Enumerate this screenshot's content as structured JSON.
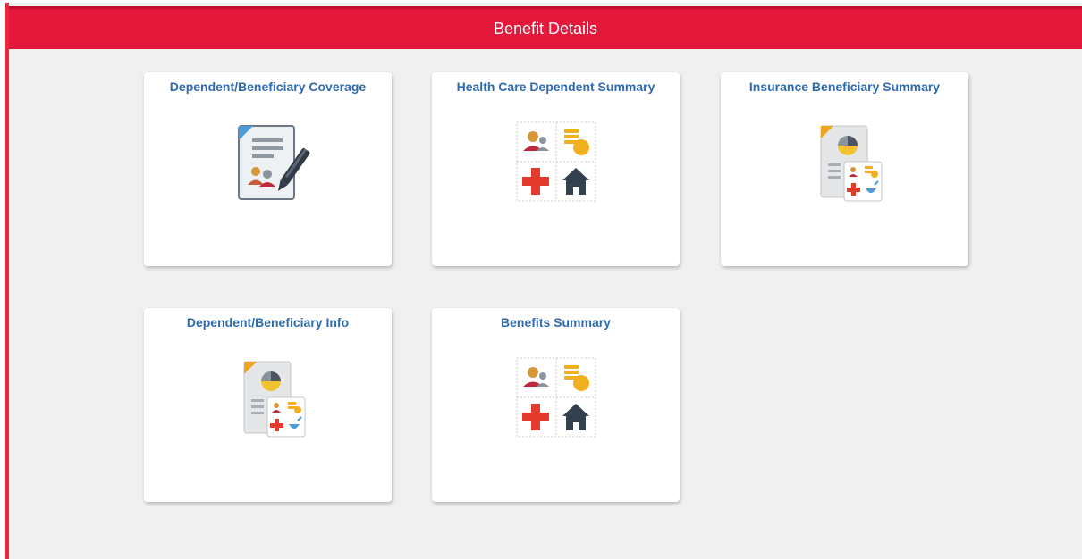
{
  "header": {
    "title": "Benefit Details"
  },
  "tiles": [
    {
      "label": "Dependent/Beneficiary Coverage",
      "icon": "document-signature-icon"
    },
    {
      "label": "Health Care Dependent Summary",
      "icon": "benefits-grid-icon"
    },
    {
      "label": "Insurance Beneficiary Summary",
      "icon": "report-chart-icon"
    },
    {
      "label": "Dependent/Beneficiary Info",
      "icon": "report-chart-icon"
    },
    {
      "label": "Benefits Summary",
      "icon": "benefits-grid-icon"
    }
  ],
  "colors": {
    "banner": "#e5173a",
    "tile_title": "#2f6bac",
    "background": "#f0f0f0"
  }
}
